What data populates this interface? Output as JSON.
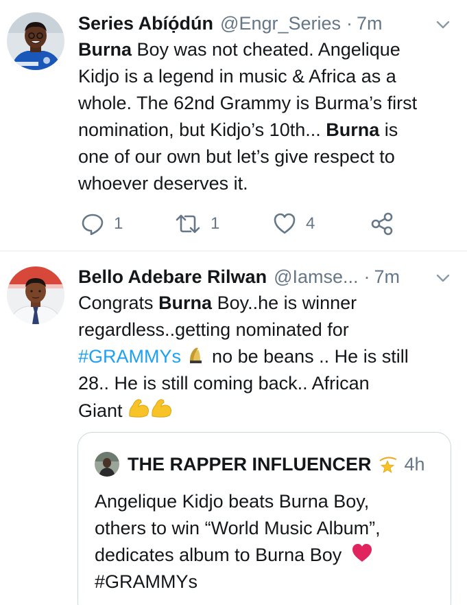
{
  "tweets": [
    {
      "name": "Series Abíọ́dún",
      "handle": "@Engr_Series",
      "separator": "·",
      "time": "7m",
      "text": {
        "l1_bold": "Burna",
        "l1_rest": " Boy was not cheated. Angelique",
        "l2": "Kidjo is a legend in music & Africa as a",
        "l3": "whole. The 62nd Grammy is Burma’s first",
        "l4_start": "nomination, but Kidjo’s 10th... ",
        "l4_bold": "Burna",
        "l4_end": " is",
        "l5": "one of our own but let’s give respect to",
        "l6": "whoever deserves it."
      },
      "actions": {
        "replies": "1",
        "retweets": "1",
        "likes": "4"
      }
    },
    {
      "name": "Bello Adebare Rilwan",
      "handle": "@Iamse...",
      "separator": "·",
      "time": "7m",
      "text": {
        "l1_start": "Congrats ",
        "l1_bold": "Burna",
        "l1_end": " Boy..he is winner",
        "l2": "regardless..getting nominated for",
        "l3_hashtag": "#GRAMMYs",
        "l3_end": " no be beans .. He is still",
        "l4": "28.. He is still coming back.. African",
        "l5": "Giant"
      },
      "quote": {
        "name": "THE RAPPER INFLUENCER",
        "time": "4h",
        "l1": "Angelique Kidjo beats Burna Boy,",
        "l2": "others to win “World Music Album”,",
        "l3": "dedicates album to Burna Boy",
        "l4": "#GRAMMYs"
      }
    }
  ],
  "icons": {
    "reply": "reply-icon",
    "retweet": "retweet-icon",
    "like": "heart-icon",
    "share": "share-icon",
    "caret": "chevron-down-icon",
    "trophy": "trophy-emoji",
    "flex": "flexed-biceps-emoji",
    "sparkle": "dizzy-star-emoji",
    "heart": "red-heart-emoji"
  },
  "colors": {
    "text": "#14171a",
    "muted": "#657786",
    "link": "#1da1f2",
    "divider": "#e6ecf0",
    "border": "#ccd6dd",
    "heart": "#e0245e",
    "emoji_yellow": "#f7c326"
  }
}
